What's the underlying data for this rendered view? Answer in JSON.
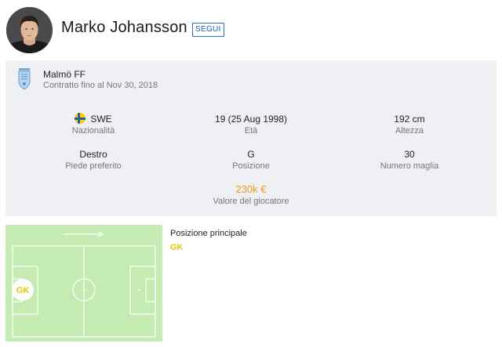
{
  "player": {
    "name": "Marko Johansson",
    "follow_label": "SEGUI"
  },
  "club": {
    "name": "Malmö FF",
    "contract": "Contratto fino al Nov 30, 2018"
  },
  "details": {
    "nationality": {
      "value": "SWE",
      "label": "Nazionalità"
    },
    "age": {
      "value": "19 (25 Aug 1998)",
      "label": "Età"
    },
    "height": {
      "value": "192 cm",
      "label": "Altezza"
    },
    "foot": {
      "value": "Destro",
      "label": "Piede preferito"
    },
    "position": {
      "value": "G",
      "label": "Posizione"
    },
    "shirt": {
      "value": "30",
      "label": "Numero maglia"
    },
    "market_value": {
      "value": "230k €",
      "label": "Valore del giocatore"
    }
  },
  "main_position": {
    "title": "Posizione principale",
    "value": "GK",
    "marker": "GK"
  },
  "colors": {
    "accent": "#1e5bb8",
    "value_orange": "#f29a1c",
    "position_yellow": "#e8c40c",
    "pitch_green": "#c4ebb2"
  },
  "icons": {
    "club": "malmo-ff-crest-icon",
    "flag": "sweden-flag-icon",
    "direction": "attack-direction-arrow-icon"
  }
}
